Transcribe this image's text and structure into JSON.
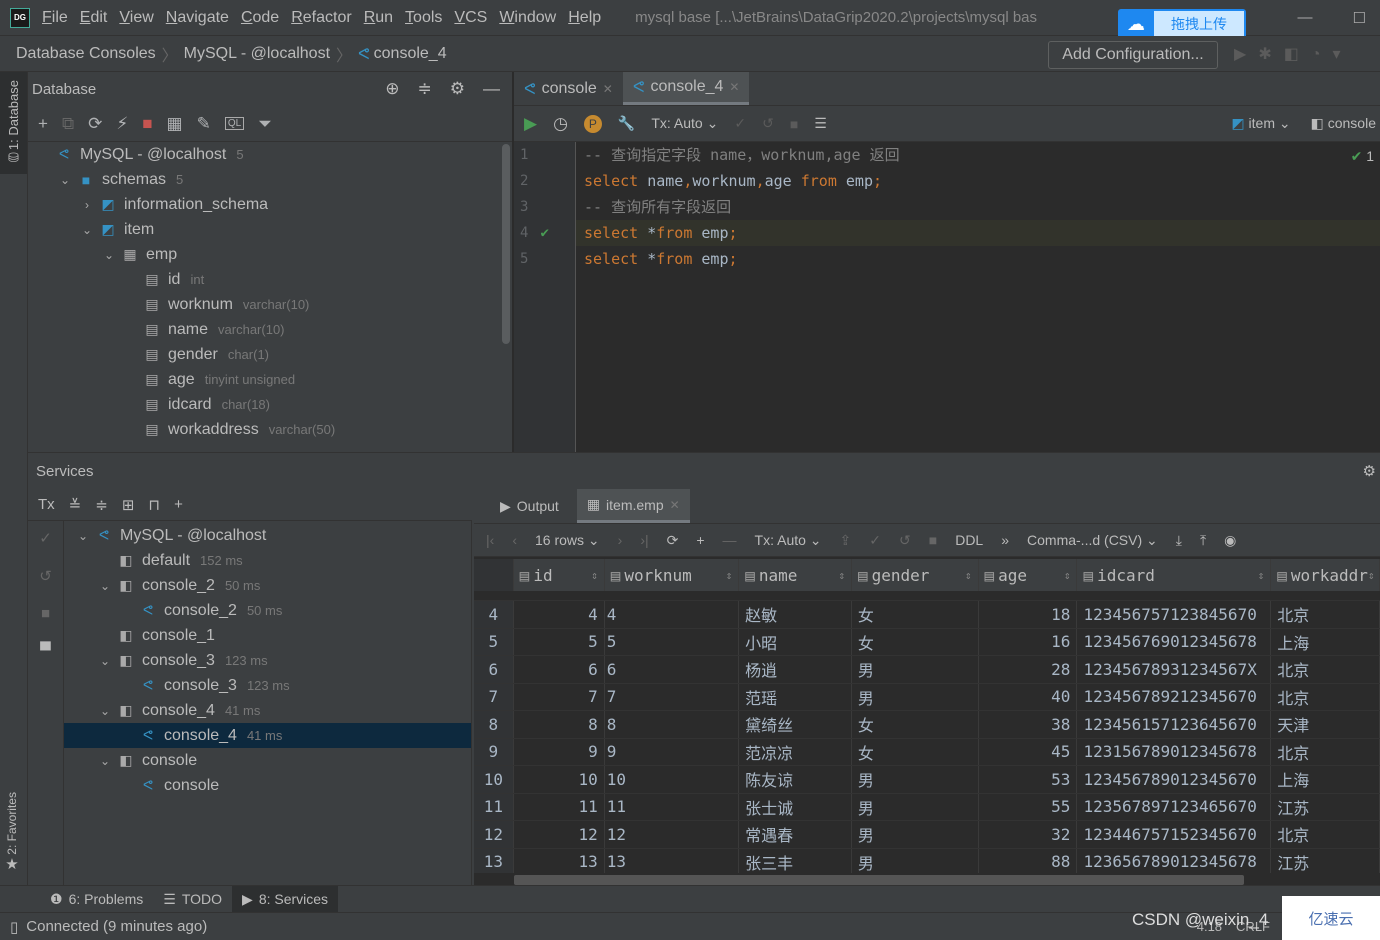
{
  "window": {
    "title": "mysql base [...\\JetBrains\\DataGrip2020.2\\projects\\mysql bas",
    "logo": "DG",
    "upload_label": "拖拽上传"
  },
  "menu": [
    "File",
    "Edit",
    "View",
    "Navigate",
    "Code",
    "Refactor",
    "Run",
    "Tools",
    "VCS",
    "Window",
    "Help"
  ],
  "breadcrumb": [
    "Database Consoles",
    "MySQL - @localhost",
    "console_4"
  ],
  "add_configuration": "Add Configuration...",
  "left_stripe": {
    "database": "1: Database",
    "favorites": "2: Favorites"
  },
  "database_panel": {
    "title": "Database",
    "tree": [
      {
        "label": "MySQL - @localhost",
        "hint": "5",
        "level": 0,
        "arrow": "",
        "icon": "mysql-icon"
      },
      {
        "label": "schemas",
        "hint": "5",
        "level": 1,
        "arrow": "down",
        "icon": "folder-icon"
      },
      {
        "label": "information_schema",
        "hint": "",
        "level": 2,
        "arrow": "right",
        "icon": "schema-icon"
      },
      {
        "label": "item",
        "hint": "",
        "level": 2,
        "arrow": "down",
        "icon": "schema-icon"
      },
      {
        "label": "emp",
        "hint": "",
        "level": 3,
        "arrow": "down",
        "icon": "table-icon"
      },
      {
        "label": "id",
        "hint": "int",
        "level": 4,
        "arrow": "",
        "icon": "column-icon"
      },
      {
        "label": "worknum",
        "hint": "varchar(10)",
        "level": 4,
        "arrow": "",
        "icon": "column-icon"
      },
      {
        "label": "name",
        "hint": "varchar(10)",
        "level": 4,
        "arrow": "",
        "icon": "column-icon"
      },
      {
        "label": "gender",
        "hint": "char(1)",
        "level": 4,
        "arrow": "",
        "icon": "column-icon"
      },
      {
        "label": "age",
        "hint": "tinyint unsigned",
        "level": 4,
        "arrow": "",
        "icon": "column-icon"
      },
      {
        "label": "idcard",
        "hint": "char(18)",
        "level": 4,
        "arrow": "",
        "icon": "column-icon"
      },
      {
        "label": "workaddress",
        "hint": "varchar(50)",
        "level": 4,
        "arrow": "",
        "icon": "column-icon"
      }
    ]
  },
  "editor": {
    "tabs": [
      {
        "label": "console",
        "active": false
      },
      {
        "label": "console_4",
        "active": true
      }
    ],
    "tx_mode": "Tx: Auto",
    "schema_selector": "item",
    "session_selector": "console",
    "inspection_count": "1",
    "lines": [
      {
        "n": "1",
        "tokens": [
          [
            "cm",
            "-- 查询指定字段 name，worknum,age 返回"
          ]
        ]
      },
      {
        "n": "2",
        "tokens": [
          [
            "kw",
            "select "
          ],
          [
            "id",
            "name"
          ],
          [
            "kw",
            ","
          ],
          [
            "id",
            "worknum"
          ],
          [
            "kw",
            ","
          ],
          [
            "id",
            "age "
          ],
          [
            "kw",
            "from "
          ],
          [
            "id",
            "emp"
          ],
          [
            "kw",
            ";"
          ]
        ]
      },
      {
        "n": "3",
        "tokens": [
          [
            "cm",
            "-- 查询所有字段返回"
          ]
        ]
      },
      {
        "n": "4",
        "tokens": [
          [
            "kw",
            "select "
          ],
          [
            "id",
            "*"
          ],
          [
            "kw",
            "from "
          ],
          [
            "id",
            "emp"
          ],
          [
            "kw",
            ";"
          ]
        ],
        "current": true
      },
      {
        "n": "5",
        "tokens": [
          [
            "kw",
            "select "
          ],
          [
            "id",
            "*"
          ],
          [
            "kw",
            "from "
          ],
          [
            "id",
            "emp"
          ],
          [
            "kw",
            ";"
          ]
        ]
      }
    ]
  },
  "services": {
    "title": "Services",
    "tree": [
      {
        "label": "MySQL - @localhost",
        "hint": "",
        "level": 0,
        "arrow": "down",
        "icon": "mysql-icon"
      },
      {
        "label": "default",
        "hint": "152 ms",
        "level": 1,
        "arrow": "",
        "icon": "session-icon"
      },
      {
        "label": "console_2",
        "hint": "50 ms",
        "level": 1,
        "arrow": "down",
        "icon": "session-icon"
      },
      {
        "label": "console_2",
        "hint": "50 ms",
        "level": 2,
        "arrow": "",
        "icon": "console-icon"
      },
      {
        "label": "console_1",
        "hint": "",
        "level": 1,
        "arrow": "",
        "icon": "session-icon"
      },
      {
        "label": "console_3",
        "hint": "123 ms",
        "level": 1,
        "arrow": "down",
        "icon": "session-icon"
      },
      {
        "label": "console_3",
        "hint": "123 ms",
        "level": 2,
        "arrow": "",
        "icon": "console-icon"
      },
      {
        "label": "console_4",
        "hint": "41 ms",
        "level": 1,
        "arrow": "down",
        "icon": "session-icon"
      },
      {
        "label": "console_4",
        "hint": "41 ms",
        "level": 2,
        "arrow": "",
        "icon": "console-icon",
        "selected": true
      },
      {
        "label": "console",
        "hint": "",
        "level": 1,
        "arrow": "down",
        "icon": "session-icon"
      },
      {
        "label": "console",
        "hint": "",
        "level": 2,
        "arrow": "",
        "icon": "console-icon"
      }
    ],
    "result_tabs": [
      {
        "label": "Output",
        "active": false
      },
      {
        "label": "item.emp",
        "active": true
      }
    ],
    "rows_label": "16 rows",
    "tx_mode": "Tx: Auto",
    "ddl_label": "DDL",
    "export_format": "Comma-...d (CSV)",
    "columns": [
      "id",
      "worknum",
      "name",
      "gender",
      "age",
      "idcard",
      "workaddr"
    ],
    "rows": [
      [
        "4",
        "4",
        "4",
        "赵敏",
        "女",
        "18",
        "123456757123845670",
        "北京"
      ],
      [
        "5",
        "5",
        "5",
        "小昭",
        "女",
        "16",
        "123456769012345678",
        "上海"
      ],
      [
        "6",
        "6",
        "6",
        "杨逍",
        "男",
        "28",
        "12345678931234567X",
        "北京"
      ],
      [
        "7",
        "7",
        "7",
        "范瑶",
        "男",
        "40",
        "123456789212345670",
        "北京"
      ],
      [
        "8",
        "8",
        "8",
        "黛绮丝",
        "女",
        "38",
        "123456157123645670",
        "天津"
      ],
      [
        "9",
        "9",
        "9",
        "范凉凉",
        "女",
        "45",
        "123156789012345678",
        "北京"
      ],
      [
        "10",
        "10",
        "10",
        "陈友谅",
        "男",
        "53",
        "123456789012345670",
        "上海"
      ],
      [
        "11",
        "11",
        "11",
        "张士诚",
        "男",
        "55",
        "123567897123465670",
        "江苏"
      ],
      [
        "12",
        "12",
        "12",
        "常遇春",
        "男",
        "32",
        "123446757152345670",
        "北京"
      ],
      [
        "13",
        "13",
        "13",
        "张三丰",
        "男",
        "88",
        "123656789012345678",
        "江苏"
      ]
    ]
  },
  "bottom_tabs": [
    {
      "label": "6: Problems",
      "icon": "problems-icon"
    },
    {
      "label": "TODO",
      "icon": "todo-icon"
    },
    {
      "label": "8: Services",
      "icon": "services-icon",
      "active": true
    }
  ],
  "status": {
    "text": "Connected (9 minutes ago)",
    "position": "4:18",
    "line_sep": "CRLF"
  },
  "watermark": {
    "csdn": "CSDN @weixin_4",
    "yisu": "亿速云"
  },
  "colors": {
    "keyword": "#cc7832",
    "comment": "#808080",
    "run_green": "#499c54",
    "accent": "#3592c4",
    "selection": "#0d293e"
  }
}
